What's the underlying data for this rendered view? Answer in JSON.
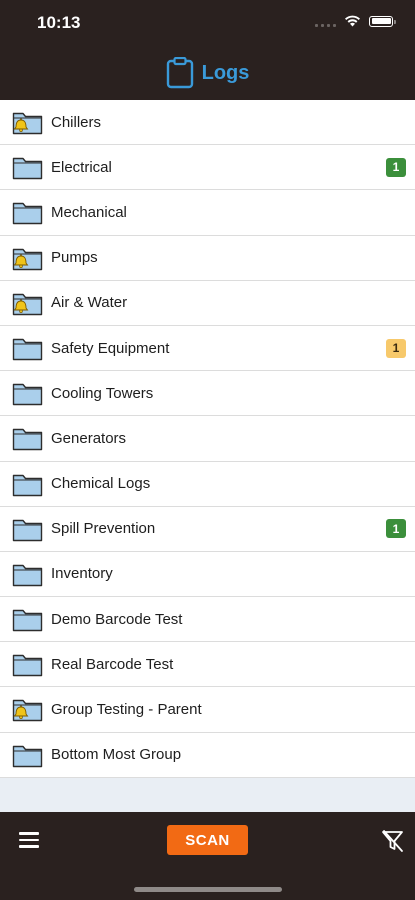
{
  "status_bar": {
    "time": "10:13"
  },
  "header": {
    "title": "Logs",
    "icon": "clipboard-icon"
  },
  "colors": {
    "accent": "#3a9ad9",
    "scan": "#f26a14",
    "badge_green": "#3b8f3b",
    "badge_yellow": "#f7c96b"
  },
  "groups": [
    {
      "label": "Chillers",
      "icon": "folder-bell-icon",
      "badge": "",
      "badge_color": ""
    },
    {
      "label": "Electrical",
      "icon": "folder-icon",
      "badge": "1",
      "badge_color": "green"
    },
    {
      "label": "Mechanical",
      "icon": "folder-icon",
      "badge": "",
      "badge_color": ""
    },
    {
      "label": "Pumps",
      "icon": "folder-bell-icon",
      "badge": "",
      "badge_color": ""
    },
    {
      "label": "Air & Water",
      "icon": "folder-bell-icon",
      "badge": "",
      "badge_color": ""
    },
    {
      "label": "Safety Equipment",
      "icon": "folder-icon",
      "badge": "1",
      "badge_color": "yellow"
    },
    {
      "label": "Cooling Towers",
      "icon": "folder-icon",
      "badge": "",
      "badge_color": ""
    },
    {
      "label": "Generators",
      "icon": "folder-icon",
      "badge": "",
      "badge_color": ""
    },
    {
      "label": "Chemical Logs",
      "icon": "folder-icon",
      "badge": "",
      "badge_color": ""
    },
    {
      "label": "Spill Prevention",
      "icon": "folder-icon",
      "badge": "1",
      "badge_color": "green"
    },
    {
      "label": "Inventory",
      "icon": "folder-icon",
      "badge": "",
      "badge_color": ""
    },
    {
      "label": "Demo Barcode Test",
      "icon": "folder-icon",
      "badge": "",
      "badge_color": ""
    },
    {
      "label": "Real Barcode Test",
      "icon": "folder-icon",
      "badge": "",
      "badge_color": ""
    },
    {
      "label": "Group Testing - Parent",
      "icon": "folder-bell-icon",
      "badge": "",
      "badge_color": ""
    },
    {
      "label": "Bottom Most Group",
      "icon": "folder-icon",
      "badge": "",
      "badge_color": ""
    }
  ],
  "toolbar": {
    "scan_label": "SCAN",
    "menu_icon": "hamburger-menu-icon",
    "filter_icon": "filter-off-icon"
  }
}
